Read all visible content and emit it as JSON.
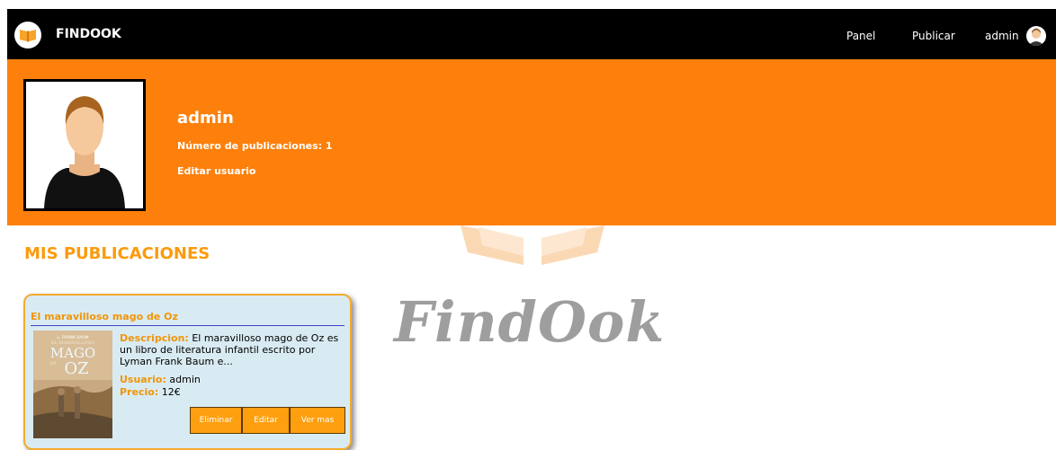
{
  "navbar": {
    "brand": "FINDOOK",
    "items": [
      {
        "label": "Panel"
      },
      {
        "label": "Publicar"
      },
      {
        "label": "admin"
      }
    ]
  },
  "profile": {
    "username": "admin",
    "publications_label": "Número de publicaciones: 1",
    "edit_label": "Editar usuario"
  },
  "watermark": {
    "text": "FindOok"
  },
  "section": {
    "title": "MIS PUBLICACIONES"
  },
  "publication": {
    "title": "El maravilloso mago de Oz",
    "description_label": "Descripcion:",
    "description": "El maravilloso mago de Oz es un libro de literatura infantil escrito por Lyman Frank Baum e...",
    "user_label": "Usuario:",
    "user": "admin",
    "price_label": "Precio:",
    "price": "12€",
    "cover": {
      "author": "L. FRANK BAUM",
      "line1": "EL MARAVILLOSO",
      "line2": "MAGO",
      "line3": "DE",
      "line4": "OZ"
    },
    "buttons": {
      "delete": "Eliminar",
      "edit": "Editar",
      "more": "Ver mas"
    }
  },
  "colors": {
    "accent": "#fd800c",
    "title_orange": "#fd9a0d",
    "card_bg": "#d9ebf2",
    "topbar": "#000000"
  }
}
